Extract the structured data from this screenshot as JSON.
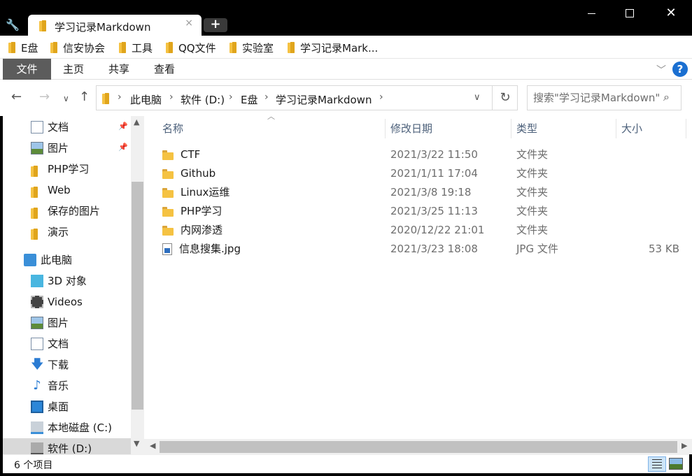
{
  "window": {
    "tab_title": "学习记录Markdown",
    "tab_close": "×",
    "new_tab": "+",
    "close_glyph": "✕"
  },
  "bookmarks": [
    {
      "label": "E盘"
    },
    {
      "label": "信安协会"
    },
    {
      "label": "工具"
    },
    {
      "label": "QQ文件"
    },
    {
      "label": "实验室"
    },
    {
      "label": "学习记录Mark..."
    }
  ],
  "ribbon": {
    "tabs": [
      "文件",
      "主页",
      "共享",
      "查看"
    ],
    "help": "?"
  },
  "address": {
    "crumbs": [
      "此电脑",
      "软件 (D:)",
      "E盘",
      "学习记录Markdown"
    ]
  },
  "search": {
    "placeholder": "搜索\"学习记录Markdown\""
  },
  "sidebar": {
    "quick_access": [
      {
        "label": "文档",
        "icon": "document-icon",
        "pinned": true
      },
      {
        "label": "图片",
        "icon": "picture-icon",
        "pinned": true
      },
      {
        "label": "PHP学习",
        "icon": "folder-icon",
        "pinned": false
      },
      {
        "label": "Web",
        "icon": "folder-icon",
        "pinned": false
      },
      {
        "label": "保存的图片",
        "icon": "folder-icon",
        "pinned": false
      },
      {
        "label": "演示",
        "icon": "folder-icon",
        "pinned": false
      }
    ],
    "this_pc": "此电脑",
    "pc_items": [
      {
        "label": "3D 对象",
        "icon": "3d-objects-icon"
      },
      {
        "label": "Videos",
        "icon": "videos-icon"
      },
      {
        "label": "图片",
        "icon": "picture-icon"
      },
      {
        "label": "文档",
        "icon": "document-icon"
      },
      {
        "label": "下载",
        "icon": "download-icon"
      },
      {
        "label": "音乐",
        "icon": "music-icon"
      },
      {
        "label": "桌面",
        "icon": "desktop-icon"
      },
      {
        "label": "本地磁盘 (C:)",
        "icon": "local-disk-icon"
      },
      {
        "label": "软件 (D:)",
        "icon": "drive-icon"
      }
    ]
  },
  "columns": {
    "name": "名称",
    "date": "修改日期",
    "type": "类型",
    "size": "大小"
  },
  "files": [
    {
      "name": "CTF",
      "date": "2021/3/22 11:50",
      "type": "文件夹",
      "size": "",
      "icon": "folder-icon"
    },
    {
      "name": "Github",
      "date": "2021/1/11 17:04",
      "type": "文件夹",
      "size": "",
      "icon": "folder-icon"
    },
    {
      "name": "Linux运维",
      "date": "2021/3/8 19:18",
      "type": "文件夹",
      "size": "",
      "icon": "folder-icon"
    },
    {
      "name": "PHP学习",
      "date": "2021/3/25 11:13",
      "type": "文件夹",
      "size": "",
      "icon": "folder-icon"
    },
    {
      "name": "内网渗透",
      "date": "2020/12/22 21:01",
      "type": "文件夹",
      "size": "",
      "icon": "folder-icon"
    },
    {
      "name": "信息搜集.jpg",
      "date": "2021/3/23 18:08",
      "type": "JPG 文件",
      "size": "53 KB",
      "icon": "jpg-file-icon"
    }
  ],
  "status": {
    "item_count": "6 个项目"
  }
}
